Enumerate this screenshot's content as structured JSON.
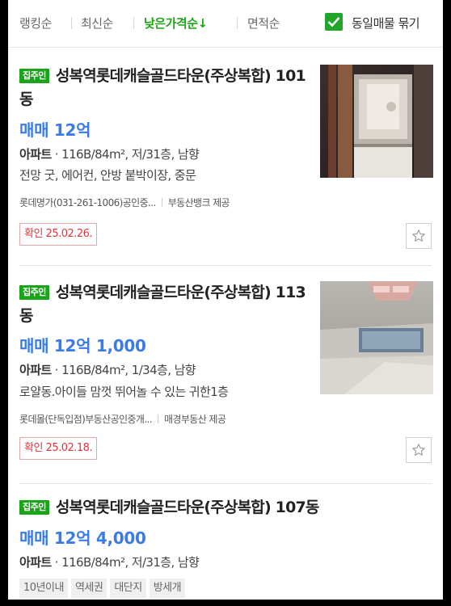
{
  "sort": {
    "options": [
      "랭킹순",
      "최신순",
      "낮은가격순↓",
      "면적순"
    ],
    "active_index": 2,
    "group_same": {
      "label": "동일매물 묶기",
      "checked": true
    }
  },
  "listings": [
    {
      "badge": "집주인",
      "title": "성복역롯데캐슬골드타운(주상복합) 101동",
      "price": "매매 12억",
      "type": "아파트",
      "specs": "116B/84m², 저/31층, 남향",
      "desc": "전망 굿, 에어컨, 안방 붙박이장, 중문",
      "agent": "롯데명가(031-261-1006)공인중...",
      "provider": "부동산뱅크 제공",
      "confirmed": "확인 25.02.26.",
      "favorite_icon": "star-outline-icon"
    },
    {
      "badge": "집주인",
      "title": "성복역롯데캐슬골드타운(주상복합) 113동",
      "price": "매매 12억 1,000",
      "type": "아파트",
      "specs": "116B/84m², 1/34층, 남향",
      "desc": "로얄동.아이들 맘껏 뛰어놀 수 있는 귀한1층",
      "agent": "롯데몰(단독입점)부동산공인중개...",
      "provider": "매경부동산 제공",
      "confirmed": "확인 25.02.18.",
      "favorite_icon": "star-outline-icon"
    },
    {
      "badge": "집주인",
      "title": "성복역롯데캐슬골드타운(주상복합) 107동",
      "price": "매매 12억 4,000",
      "type": "아파트",
      "specs": "116B/84m², 저/31층, 남향",
      "tags": [
        "10년이내",
        "역세권",
        "대단지",
        "방세개"
      ]
    }
  ],
  "colors": {
    "accent_green": "#1fa514",
    "price_blue": "#3b7be6",
    "confirm_red": "#e0353a"
  }
}
